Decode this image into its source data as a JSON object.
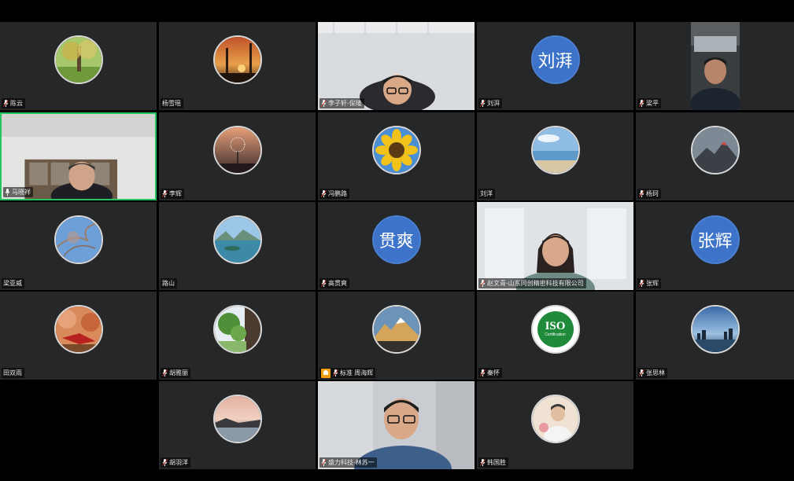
{
  "participants": [
    {
      "name": "陈云",
      "mic": true
    },
    {
      "name": "杨雪瑶",
      "mic": false
    },
    {
      "name": "李子轩-保隆",
      "mic": true
    },
    {
      "name": "刘湃",
      "mic": true,
      "avatar_text": "刘湃"
    },
    {
      "name": "梁平",
      "mic": true
    },
    {
      "name": "马晓祥",
      "mic": true
    },
    {
      "name": "李辉",
      "mic": true
    },
    {
      "name": "冯鹏路",
      "mic": true
    },
    {
      "name": "刘洋",
      "mic": false
    },
    {
      "name": "杨珂",
      "mic": true
    },
    {
      "name": "梁亚威",
      "mic": false
    },
    {
      "name": "路山",
      "mic": false
    },
    {
      "name": "高贯爽",
      "mic": true,
      "avatar_text": "贯爽"
    },
    {
      "name": "赵文青-山东同创精密科技有限公司",
      "mic": true
    },
    {
      "name": "张辉",
      "mic": true,
      "avatar_text": "张辉"
    },
    {
      "name": "田双雨",
      "mic": false
    },
    {
      "name": "胡雅丽",
      "mic": true
    },
    {
      "name": "标准 周海辉",
      "mic": false,
      "org_icon": true
    },
    {
      "name": "秦怀",
      "mic": true,
      "avatar_iso": {
        "big": "ISO",
        "small": "Certification"
      }
    },
    {
      "name": "张思林",
      "mic": true
    },
    {
      "name": "胡羽洋",
      "mic": true
    },
    {
      "name": "盛力科技-林苏一",
      "mic": true
    },
    {
      "name": "韩国胜",
      "mic": true
    }
  ],
  "colors": {
    "tile_bg": "#262729",
    "active_border": "#22c55e",
    "name_avatar": "#3d73c9"
  }
}
